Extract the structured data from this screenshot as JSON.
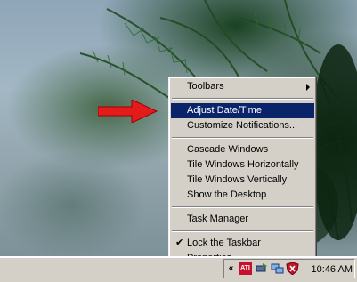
{
  "context_menu": {
    "items": [
      {
        "label": "Toolbars"
      },
      {
        "label": "Adjust Date/Time"
      },
      {
        "label": "Customize Notifications..."
      },
      {
        "label": "Cascade Windows"
      },
      {
        "label": "Tile Windows Horizontally"
      },
      {
        "label": "Tile Windows Vertically"
      },
      {
        "label": "Show the Desktop"
      },
      {
        "label": "Task Manager"
      },
      {
        "label": "Lock the Taskbar"
      },
      {
        "label": "Properties"
      }
    ],
    "selected_color": "#0a246a"
  },
  "annotation": {
    "arrow_color": "#e31b1b",
    "icon": "red-arrow-icon"
  },
  "tray": {
    "chevron": "«",
    "ati_label": "ATI",
    "clock": "10:46 AM",
    "icons": [
      "show-hidden-icons-chevron",
      "ati-icon",
      "safely-remove-icon",
      "network-icon",
      "security-shield-icon"
    ]
  }
}
